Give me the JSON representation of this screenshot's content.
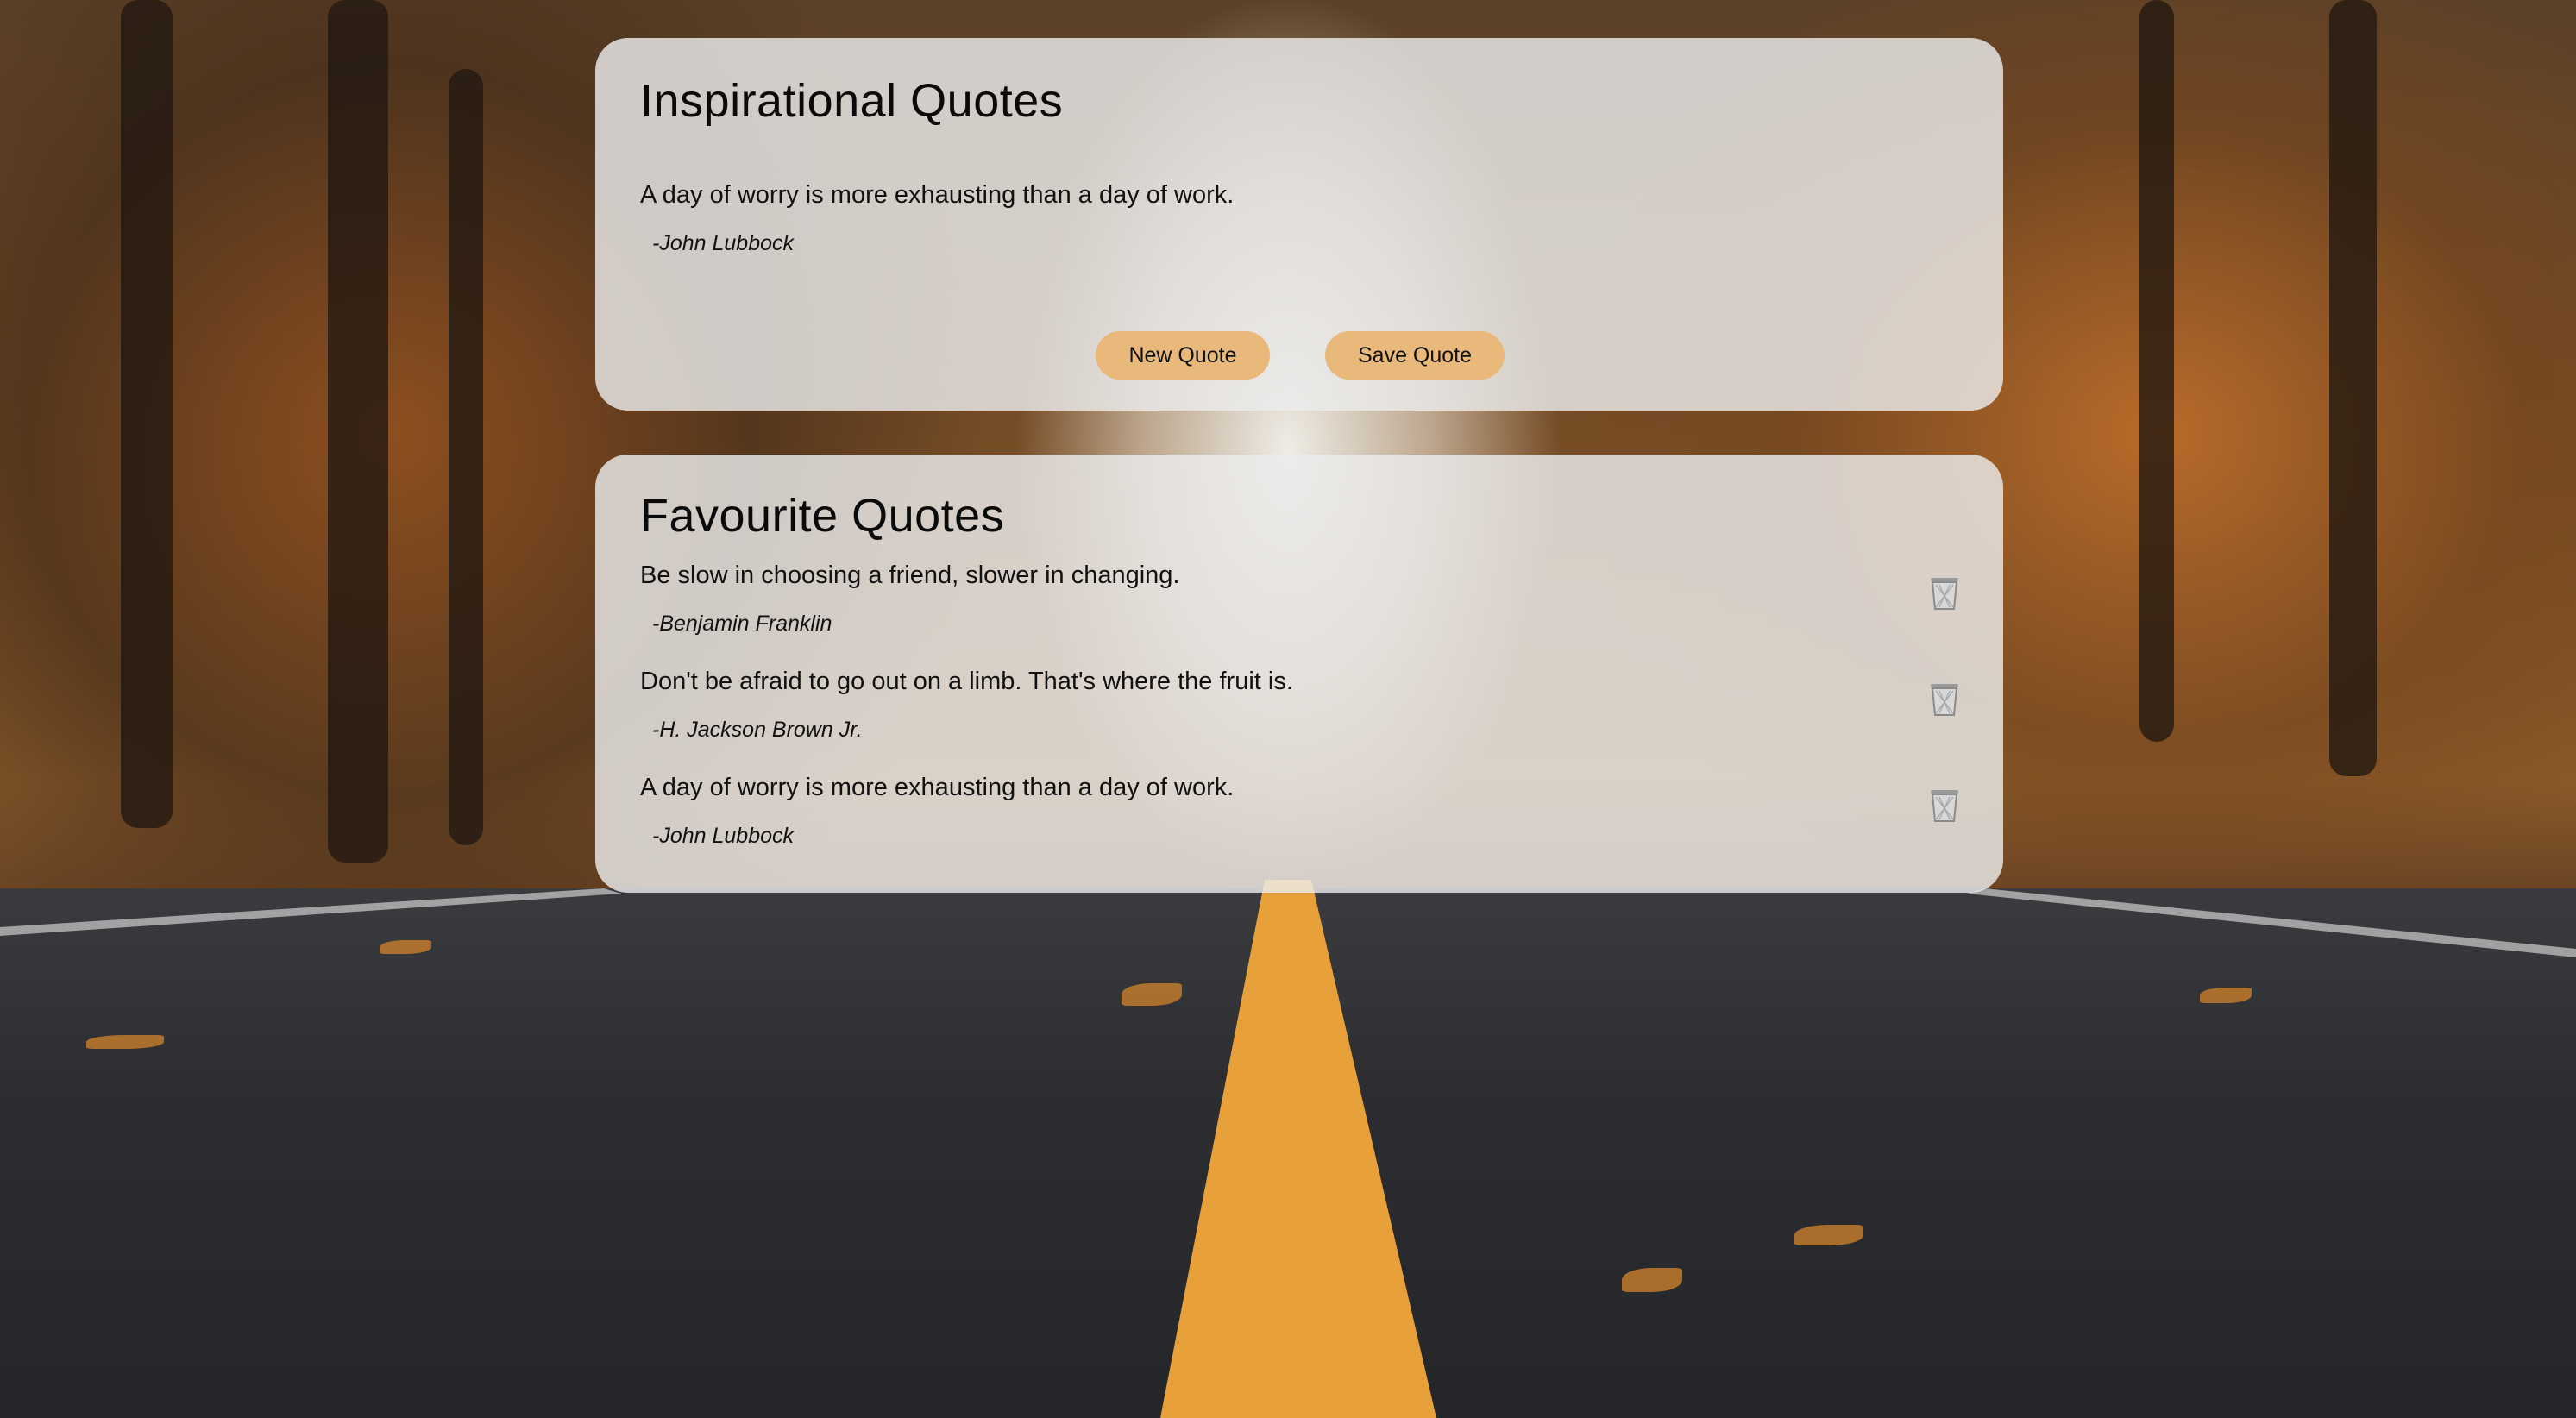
{
  "generator": {
    "title": "Inspirational Quotes",
    "quote": "A day of worry is more exhausting than a day of work.",
    "author": "-John Lubbock",
    "new_button": "New Quote",
    "save_button": "Save Quote"
  },
  "favourites": {
    "title": "Favourite Quotes",
    "items": [
      {
        "quote": "Be slow in choosing a friend, slower in changing.",
        "author": "-Benjamin Franklin",
        "delete_icon": "trash-icon"
      },
      {
        "quote": "Don't be afraid to go out on a limb. That's where the fruit is.",
        "author": "-H. Jackson Brown Jr.",
        "delete_icon": "trash-icon"
      },
      {
        "quote": "A day of worry is more exhausting than a day of work.",
        "author": "-John Lubbock",
        "delete_icon": "trash-icon"
      }
    ]
  },
  "colors": {
    "button": "#e8b97a",
    "card": "#ececec"
  }
}
